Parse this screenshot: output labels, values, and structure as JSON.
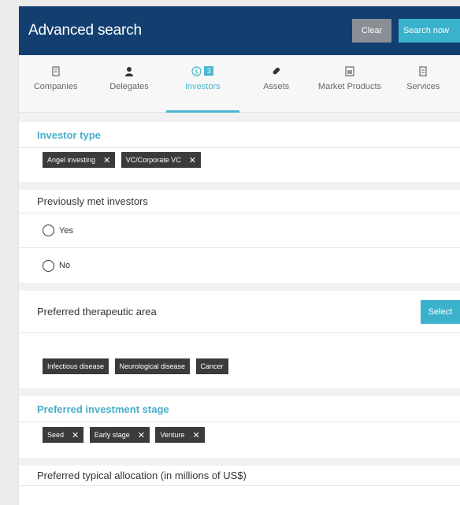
{
  "header": {
    "title": "Advanced search",
    "clear_label": "Clear",
    "search_label": "Search now"
  },
  "tabs": [
    {
      "label": "Companies",
      "icon": "building-icon"
    },
    {
      "label": "Delegates",
      "icon": "person-icon"
    },
    {
      "label": "Investors",
      "icon": "dollar-icon",
      "badge": "3",
      "active": true
    },
    {
      "label": "Assets",
      "icon": "pill-icon"
    },
    {
      "label": "Market Products",
      "icon": "product-icon"
    },
    {
      "label": "Services",
      "icon": "document-icon"
    }
  ],
  "investor_type": {
    "title": "Investor type",
    "chips": [
      "Angel investing",
      "VC/Corporate VC"
    ]
  },
  "previously_met": {
    "title": "Previously met investors",
    "options": [
      "Yes",
      "No"
    ]
  },
  "therapeutic_area": {
    "title": "Preferred therapeutic area",
    "select_label": "Select",
    "chips": [
      "Infectious disease",
      "Neurological disease",
      "Cancer"
    ]
  },
  "investment_stage": {
    "title": "Preferred investment stage",
    "chips": [
      "Seed",
      "Early stage",
      "Venture"
    ]
  },
  "allocation": {
    "title": "Preferred typical allocation (in millions of US$)"
  },
  "colors": {
    "header": "#123f70",
    "accent": "#3bb2cc",
    "chip": "#3b3b3b"
  }
}
